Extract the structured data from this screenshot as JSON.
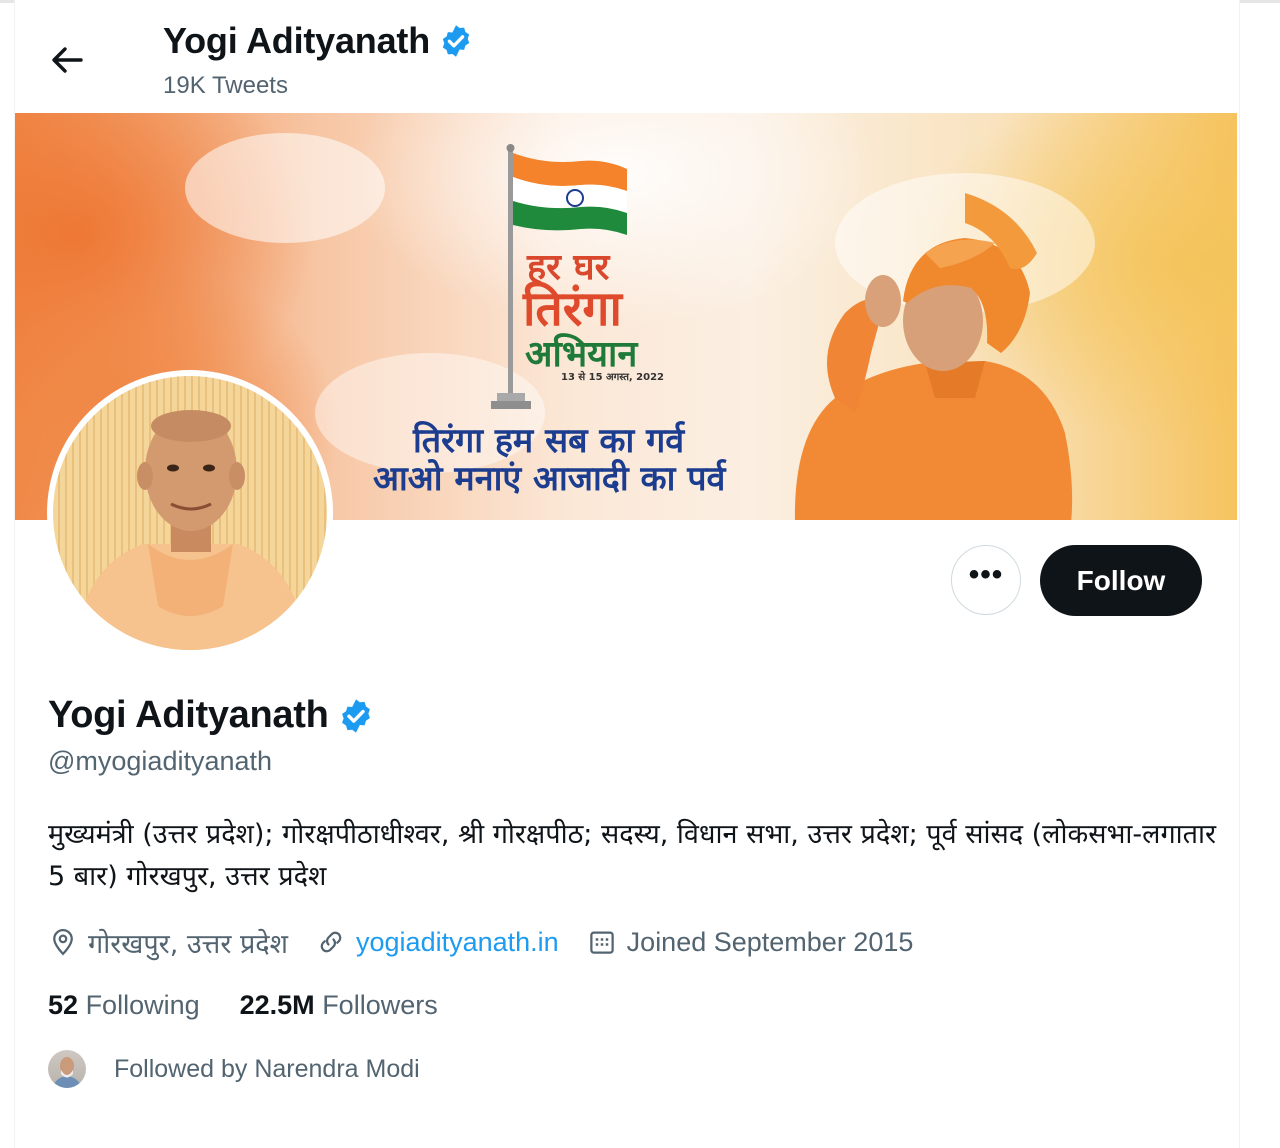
{
  "header": {
    "name": "Yogi Adityanath",
    "tweets_count": "19K Tweets"
  },
  "banner": {
    "slogan_line1": "हर घर",
    "slogan_line2": "तिरंगा",
    "slogan_line3": "अभियान",
    "date_text": "13 से 15 अगस्त, 2022",
    "tagline_line1": "तिरंगा हम सब का गर्व",
    "tagline_line2": "आओ मनाएं आजादी का पर्व"
  },
  "actions": {
    "more_label": "•••",
    "follow_label": "Follow"
  },
  "profile": {
    "display_name": "Yogi Adityanath",
    "handle": "@myogiadityanath",
    "bio": "मुख्यमंत्री (उत्तर प्रदेश); गोरक्षपीठाधीश्वर, श्री गोरक्षपीठ; सदस्य, विधान सभा, उत्तर प्रदेश; पूर्व सांसद (लोकसभा-लगातार 5 बार) गोरखपुर, उत्तर प्रदेश",
    "location": "गोरखपुर, उत्तर प्रदेश",
    "website": "yogiadityanath.in",
    "joined": "Joined September 2015"
  },
  "stats": {
    "following_count": "52",
    "following_label": "Following",
    "followers_count": "22.5M",
    "followers_label": "Followers"
  },
  "followed_by": "Followed by Narendra Modi",
  "colors": {
    "verified": "#1d9bf0",
    "link": "#1d9bf0",
    "follow_button": "#0f1419",
    "secondary_text": "#536471"
  },
  "icons": [
    "back-arrow-icon",
    "verified-badge-icon",
    "location-pin-icon",
    "link-icon",
    "calendar-icon"
  ]
}
